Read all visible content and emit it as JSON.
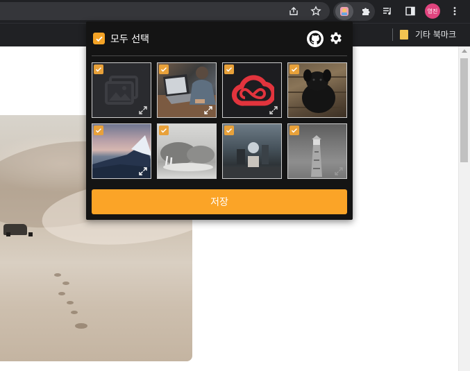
{
  "browser": {
    "profile_initials": "영진",
    "bookmarks_label": "기타 북마크",
    "accent_color": "#e0447e"
  },
  "popup": {
    "select_all_label": "모두 선택",
    "save_label": "저장",
    "accent_color": "#fba427",
    "images": [
      {
        "icon": "image-placeholder-icon",
        "checked": true
      },
      {
        "icon": "laptop-photo",
        "checked": true
      },
      {
        "icon": "adobe-creative-cloud-logo",
        "checked": true
      },
      {
        "icon": "black-dog-photo",
        "checked": true
      },
      {
        "icon": "mountain-sunset-photo",
        "checked": true
      },
      {
        "icon": "walrus-photo",
        "checked": true
      },
      {
        "icon": "cafe-photo",
        "checked": true
      },
      {
        "icon": "lighthouse-photo",
        "checked": true
      }
    ]
  }
}
